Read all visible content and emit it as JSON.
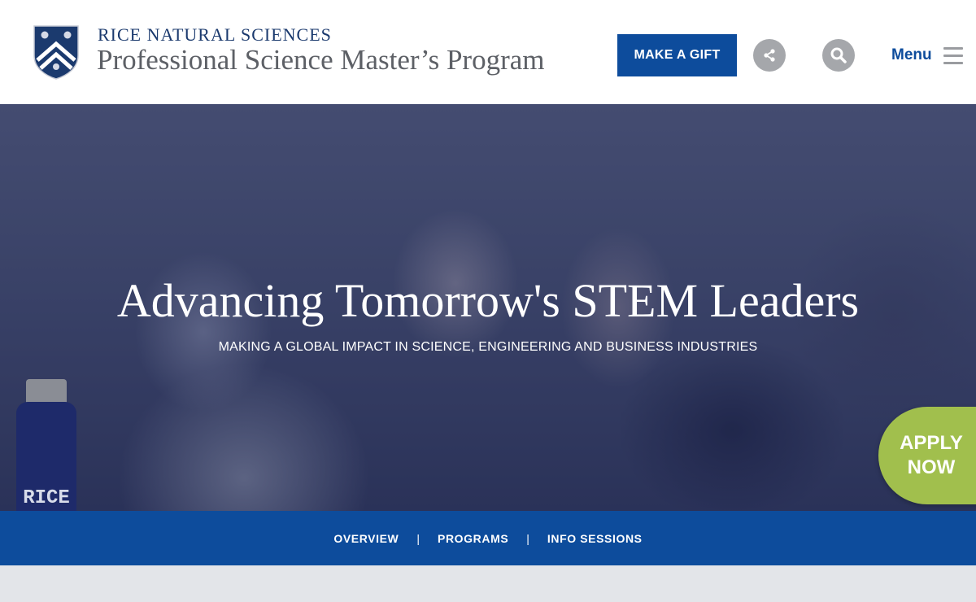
{
  "header": {
    "brand_top": "RICE NATURAL SCIENCES",
    "brand_main": "Professional Science Master’s Program",
    "gift_label": "MAKE A GIFT",
    "share_icon": "share-icon",
    "search_icon": "search-icon",
    "menu_label": "Menu",
    "menu_icon": "hamburger-icon"
  },
  "hero": {
    "title": "Advancing Tomorrow's STEM Leaders",
    "subtitle": "MAKING A GLOBAL IMPACT IN SCIENCE, ENGINEERING AND BUSINESS INDUSTRIES",
    "bottle_text": "RICE",
    "apply_line1": "APPLY",
    "apply_line2": "NOW"
  },
  "nav": {
    "items": [
      {
        "label": "OVERVIEW"
      },
      {
        "label": "PROGRAMS"
      },
      {
        "label": "INFO SESSIONS"
      }
    ],
    "separator": "|"
  },
  "colors": {
    "brand_blue": "#0d4c9c",
    "navy": "#1b3a6e",
    "apply_green": "#a1bf4d",
    "icon_gray": "#a5a7ab",
    "footer_gray": "#e3e5e9"
  }
}
